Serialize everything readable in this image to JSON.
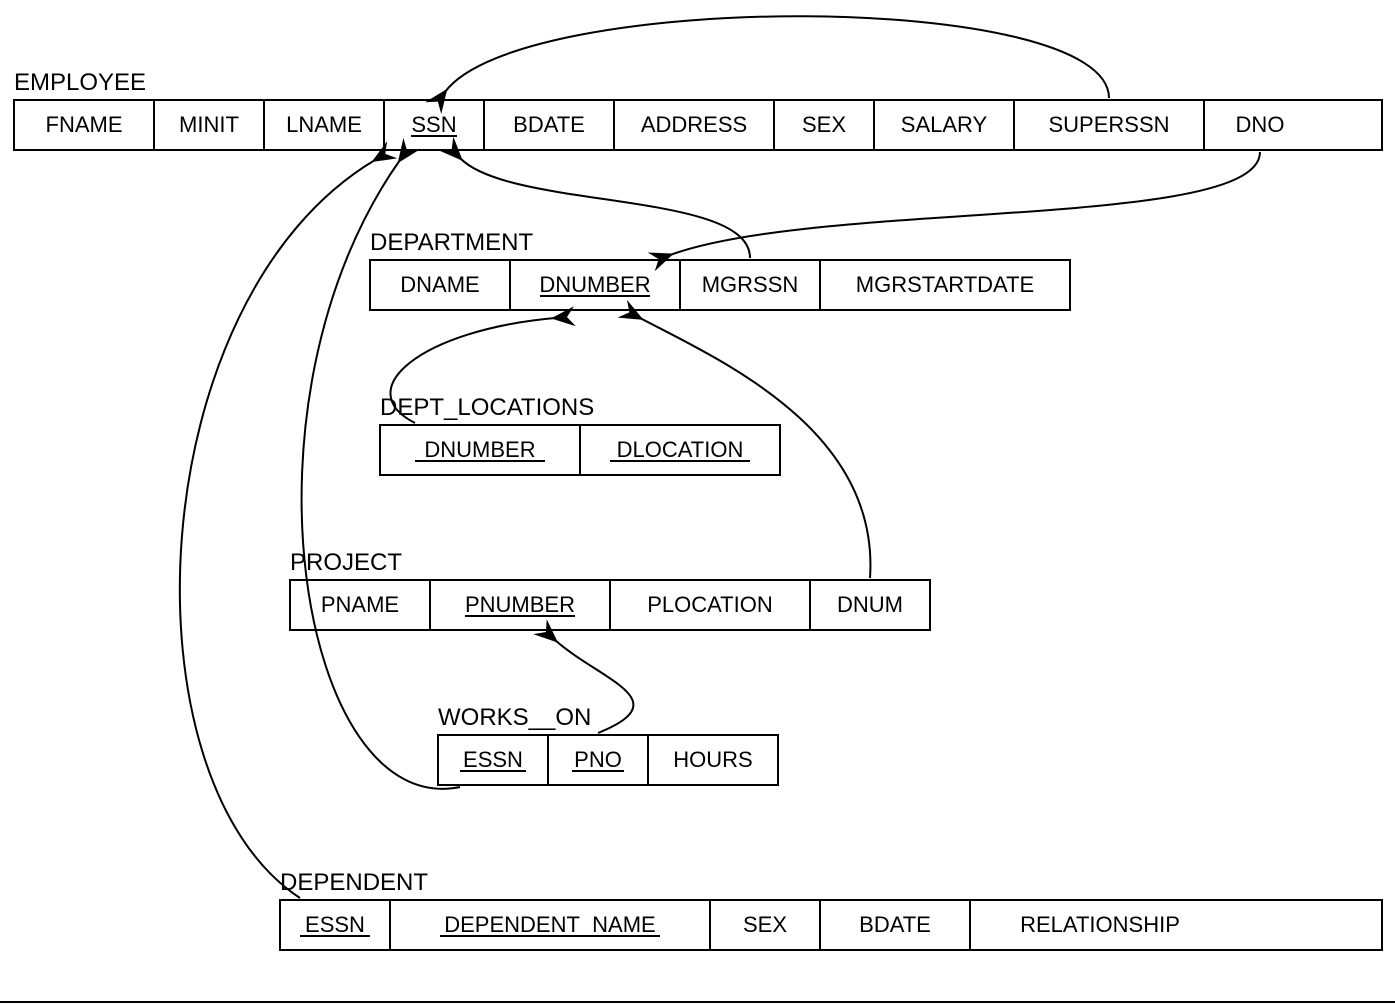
{
  "tables": {
    "employee": {
      "title": "EMPLOYEE",
      "attrs": [
        "FNAME",
        "MINIT",
        "LNAME",
        "SSN",
        "BDATE",
        "ADDRESS",
        "SEX",
        "SALARY",
        "SUPERSSN",
        "DNO"
      ],
      "keys": [
        "SSN"
      ]
    },
    "department": {
      "title": "DEPARTMENT",
      "attrs": [
        "DNAME",
        "DNUMBER",
        "MGRSSN",
        "MGRSTARTDATE"
      ],
      "keys": [
        "DNUMBER"
      ]
    },
    "dept_locations": {
      "title": "DEPT_LOCATIONS",
      "attrs": [
        "DNUMBER",
        "DLOCATION"
      ],
      "keys": [
        "DNUMBER",
        "DLOCATION"
      ]
    },
    "project": {
      "title": "PROJECT",
      "attrs": [
        "PNAME",
        "PNUMBER",
        "PLOCATION",
        "DNUM"
      ],
      "keys": [
        "PNUMBER"
      ]
    },
    "works_on": {
      "title": "WORKS__ON",
      "attrs": [
        "ESSN",
        "PNO",
        "HOURS"
      ],
      "keys": [
        "ESSN",
        "PNO"
      ]
    },
    "dependent": {
      "title": "DEPENDENT",
      "attrs": [
        "ESSN",
        "DEPENDENT_NAME",
        "SEX",
        "BDATE",
        "RELATIONSHIP"
      ],
      "keys": [
        "ESSN",
        "DEPENDENT_NAME"
      ]
    }
  },
  "references": [
    {
      "from": "EMPLOYEE.SUPERSSN",
      "to": "EMPLOYEE.SSN"
    },
    {
      "from": "EMPLOYEE.DNO",
      "to": "DEPARTMENT.DNUMBER"
    },
    {
      "from": "DEPARTMENT.MGRSSN",
      "to": "EMPLOYEE.SSN"
    },
    {
      "from": "DEPT_LOCATIONS.DNUMBER",
      "to": "DEPARTMENT.DNUMBER"
    },
    {
      "from": "PROJECT.DNUM",
      "to": "DEPARTMENT.DNUMBER"
    },
    {
      "from": "WORKS_ON.ESSN",
      "to": "EMPLOYEE.SSN"
    },
    {
      "from": "WORKS_ON.PNO",
      "to": "PROJECT.PNUMBER"
    },
    {
      "from": "DEPENDENT.ESSN",
      "to": "EMPLOYEE.SSN"
    }
  ]
}
